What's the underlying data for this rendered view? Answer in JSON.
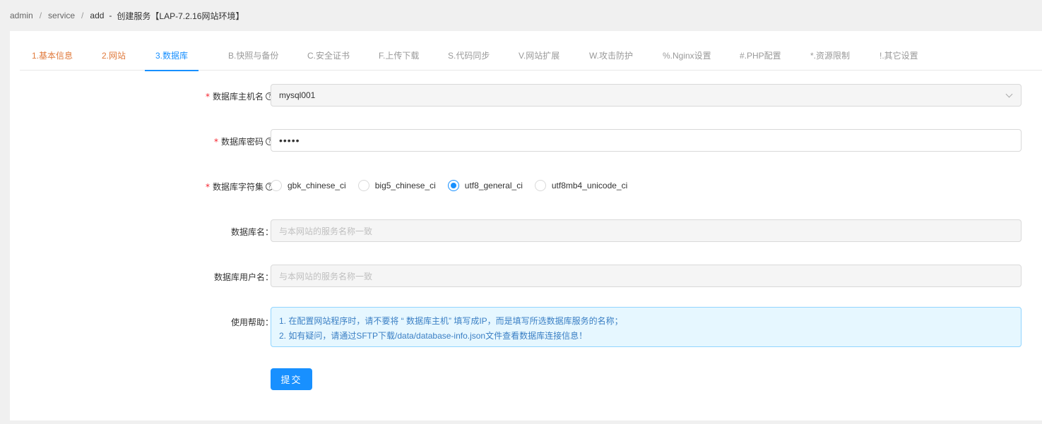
{
  "breadcrumb": {
    "items": [
      "admin",
      "service",
      "add"
    ],
    "separator": "/",
    "title_sep": "-",
    "title": "创建服务【LAP-7.2.16网站环境】"
  },
  "tabs": [
    {
      "label": "1.基本信息",
      "state": "done"
    },
    {
      "label": "2.网站",
      "state": "done"
    },
    {
      "label": "3.数据库",
      "state": "active"
    },
    {
      "label": "B.快照与备份",
      "state": "pending"
    },
    {
      "label": "C.安全证书",
      "state": "pending"
    },
    {
      "label": "F.上传下载",
      "state": "pending"
    },
    {
      "label": "S.代码同步",
      "state": "pending"
    },
    {
      "label": "V.网站扩展",
      "state": "pending"
    },
    {
      "label": "W.攻击防护",
      "state": "pending"
    },
    {
      "label": "%.Nginx设置",
      "state": "pending"
    },
    {
      "label": "#.PHP配置",
      "state": "pending"
    },
    {
      "label": "*.资源限制",
      "state": "pending"
    },
    {
      "label": "!.其它设置",
      "state": "pending"
    }
  ],
  "form": {
    "db_host": {
      "label": "数据库主机名",
      "required_mark": "*",
      "value": "mysql001",
      "help_icon": "question-circle-icon"
    },
    "db_password": {
      "label": "数据库密码",
      "required_mark": "*",
      "value": "•••••",
      "help_icon": "question-circle-icon"
    },
    "db_charset": {
      "label": "数据库字符集",
      "required_mark": "*",
      "help_icon": "question-circle-icon",
      "options": [
        "gbk_chinese_ci",
        "big5_chinese_ci",
        "utf8_general_ci",
        "utf8mb4_unicode_ci"
      ],
      "selected": "utf8_general_ci"
    },
    "db_name": {
      "label": "数据库名：",
      "placeholder": "与本网站的服务名称一致"
    },
    "db_user": {
      "label": "数据库用户名：",
      "placeholder": "与本网站的服务名称一致"
    },
    "help": {
      "label": "使用帮助：",
      "lines": [
        "1. 在配置网站程序时，请不要将 “ 数据库主机” 填写成IP，而是填写所选数据库服务的名称；",
        "2. 如有疑问，请通过SFTP下载/data/database-info.json文件查看数据库连接信息！"
      ]
    },
    "submit_label": "提交"
  },
  "colors": {
    "primary": "#1890ff",
    "done_tab": "#e07a3c",
    "required": "#f5222d",
    "alert_bg": "#e6f7ff"
  }
}
